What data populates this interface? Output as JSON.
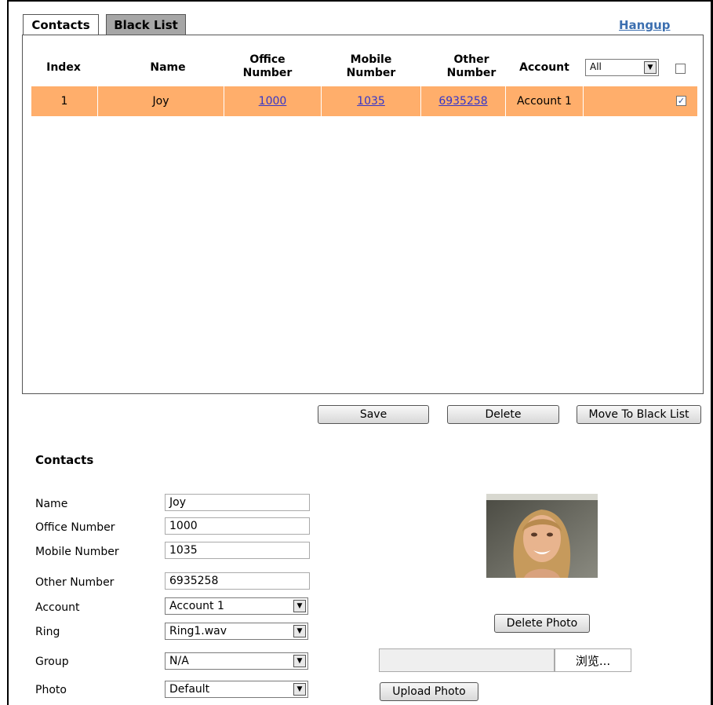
{
  "tabs": {
    "contacts": "Contacts",
    "black_list": "Black List"
  },
  "hangup": "Hangup",
  "table": {
    "headers": {
      "index": "Index",
      "name": "Name",
      "office": [
        "Office",
        "Number"
      ],
      "mobile": [
        "Mobile",
        "Number"
      ],
      "other": [
        "Other",
        "Number"
      ],
      "account": "Account"
    },
    "account_filter": "All",
    "rows": [
      {
        "index": "1",
        "name": "Joy",
        "office": "1000",
        "mobile": "1035",
        "other": "6935258",
        "account": "Account 1",
        "checked": true
      }
    ],
    "row_highlight": "#ffae6b"
  },
  "buttons": {
    "save": "Save",
    "delete": "Delete",
    "move_to_black_list": "Move To Black List"
  },
  "form": {
    "title": "Contacts",
    "labels": {
      "name": "Name",
      "office": "Office Number",
      "mobile": "Mobile Number",
      "other": "Other Number",
      "account": "Account",
      "ring": "Ring",
      "group": "Group",
      "photo": "Photo"
    },
    "values": {
      "name": "Joy",
      "office": "1000",
      "mobile": "1035",
      "other": "6935258",
      "account": "Account 1",
      "ring": "Ring1.wav",
      "group": "N/A",
      "photo": "Default"
    }
  },
  "photo_buttons": {
    "delete": "Delete Photo",
    "browse": "浏览...",
    "upload": "Upload Photo"
  },
  "colors": {
    "tab_inactive": "#a6a6a6",
    "hangup_link": "#3c6fb0",
    "link": "#3535c8"
  }
}
